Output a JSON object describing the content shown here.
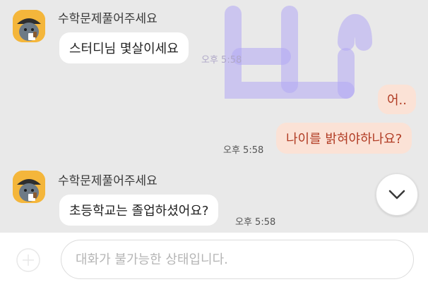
{
  "messages": [
    {
      "sender": "수학문제풀어주세요",
      "text": "스터디님 몇살이세요",
      "time": "오후 5:58"
    },
    {
      "text1": "어..",
      "text2": "나이를 밝혀야하나요?",
      "time": "오후 5:58"
    },
    {
      "sender": "수학문제풀어주세요",
      "text": "초등학교는 졸업하셨어요?",
      "time": "오후 5:58"
    }
  ],
  "input": {
    "placeholder": "대화가 불가능한 상태입니다."
  },
  "icons": {
    "scroll_down": "chevron-down-icon",
    "attach": "plus-circle-icon"
  },
  "colors": {
    "background": "#e9e9e9",
    "bubble_received": "#ffffff",
    "bubble_sent": "#fbe2d6",
    "bubble_sent_text": "#b13c24",
    "avatar_bg": "#f4b63b"
  }
}
